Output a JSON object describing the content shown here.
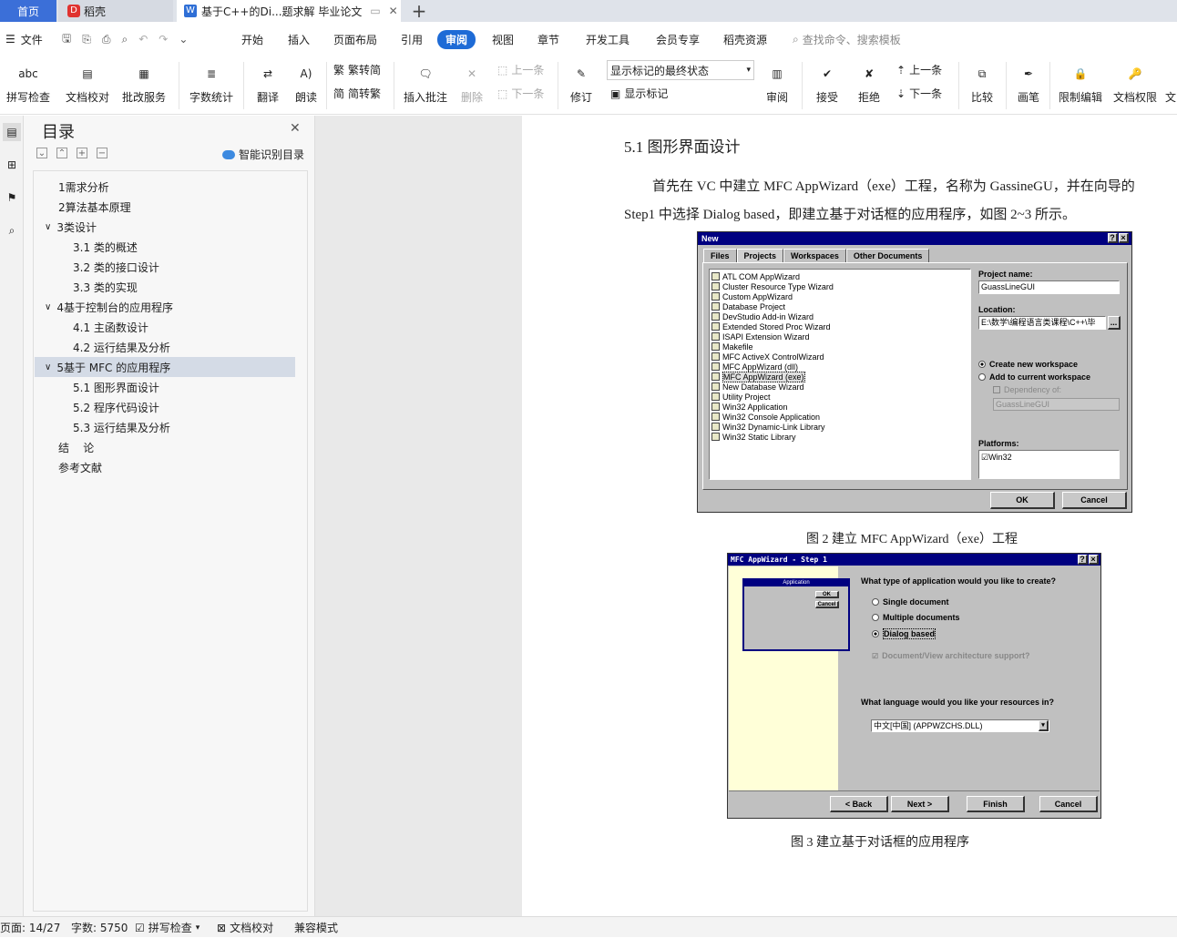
{
  "tabs": {
    "home": "首页",
    "docer": "稻壳",
    "doc": "基于C++的Di...题求解 毕业论文"
  },
  "menu": {
    "file": "文件",
    "items": [
      "开始",
      "插入",
      "页面布局",
      "引用",
      "审阅",
      "视图",
      "章节",
      "开发工具",
      "会员专享",
      "稻壳资源"
    ],
    "active": "审阅",
    "search": "查找命令、搜索模板"
  },
  "ribbon": {
    "spell": "拼写检查",
    "proof": "文档校对",
    "review_svc": "批改服务",
    "wordcount": "字数统计",
    "translate": "翻译",
    "read": "朗读",
    "t2s": "繁转简",
    "s2t": "简转繁",
    "insert_comment": "插入批注",
    "delete": "删除",
    "prev_comment": "上一条",
    "next_comment": "下一条",
    "track": "修订",
    "track_dropdown": "显示标记的最终状态",
    "show_markup": "显示标记",
    "review": "审阅",
    "accept": "接受",
    "reject": "拒绝",
    "prev": "上一条",
    "next": "下一条",
    "compare": "比较",
    "ink": "画笔",
    "restrict": "限制编辑",
    "permission": "文档权限",
    "more": "文"
  },
  "toc": {
    "title": "目录",
    "smart": "智能识别目录",
    "items": [
      {
        "label": "1需求分析"
      },
      {
        "label": "2算法基本原理"
      },
      {
        "label": "3类设计"
      },
      {
        "label": "3.1  类的概述"
      },
      {
        "label": "3.2  类的接口设计"
      },
      {
        "label": "3.3  类的实现"
      },
      {
        "label": "4基于控制台的应用程序"
      },
      {
        "label": "4.1  主函数设计"
      },
      {
        "label": "4.2  运行结果及分析"
      },
      {
        "label": "5基于 MFC 的应用程序"
      },
      {
        "label": "5.1  图形界面设计"
      },
      {
        "label": "5.2  程序代码设计"
      },
      {
        "label": "5.3  运行结果及分析"
      },
      {
        "label": "结    论"
      },
      {
        "label": "参考文献"
      }
    ]
  },
  "doc": {
    "heading": "5.1  图形界面设计",
    "para1": "首先在 VC 中建立 MFC AppWizard（exe）工程，名称为 GassineGU，并在向导的",
    "para2": "Step1 中选择 Dialog based，即建立基于对话框的应用程序，如图 2~3 所示。",
    "cap1": "图 2  建立 MFC AppWizard（exe）工程",
    "cap2": "图 3  建立基于对话框的应用程序"
  },
  "dlg1": {
    "title": "New",
    "tabs": [
      "Files",
      "Projects",
      "Workspaces",
      "Other Documents"
    ],
    "projects": [
      "ATL COM AppWizard",
      "Cluster Resource Type Wizard",
      "Custom AppWizard",
      "Database Project",
      "DevStudio Add-in Wizard",
      "Extended Stored Proc Wizard",
      "ISAPI Extension Wizard",
      "Makefile",
      "MFC ActiveX ControlWizard",
      "MFC AppWizard (dll)",
      "MFC AppWizard (exe)",
      "New Database Wizard",
      "Utility Project",
      "Win32 Application",
      "Win32 Console Application",
      "Win32 Dynamic-Link Library",
      "Win32 Static Library"
    ],
    "project_name_label": "Project name:",
    "project_name": "GuassLineGUI",
    "location_label": "Location:",
    "location": "E:\\数学\\编程语言类课程\\C++\\毕",
    "create_new": "Create new workspace",
    "add_current": "Add to current workspace",
    "dependency": "Dependency of:",
    "dependency_val": "GuassLineGUI",
    "platforms": "Platforms:",
    "platform": "Win32",
    "ok": "OK",
    "cancel": "Cancel",
    "browse": "..."
  },
  "dlg2": {
    "title": "MFC AppWizard - Step 1",
    "preview_title": "Application",
    "preview_ok": "OK",
    "preview_cancel": "Cancel",
    "question": "What type of application would you like to create?",
    "opt1": "Single document",
    "opt2": "Multiple documents",
    "opt3": "Dialog based",
    "docview": "Document/View architecture support?",
    "lang_q": "What language would you like your resources in?",
    "lang": "中文[中国] (APPWZCHS.DLL)",
    "back": "< Back",
    "next": "Next >",
    "finish": "Finish",
    "cancel": "Cancel"
  },
  "status": {
    "page": "页面: 14/27",
    "words": "字数: 5750",
    "spell": "拼写检查",
    "proof": "文档校对",
    "compat": "兼容模式"
  },
  "colors": {
    "accent": "#3b6fd8",
    "tab_active": "#1e6bd6"
  }
}
